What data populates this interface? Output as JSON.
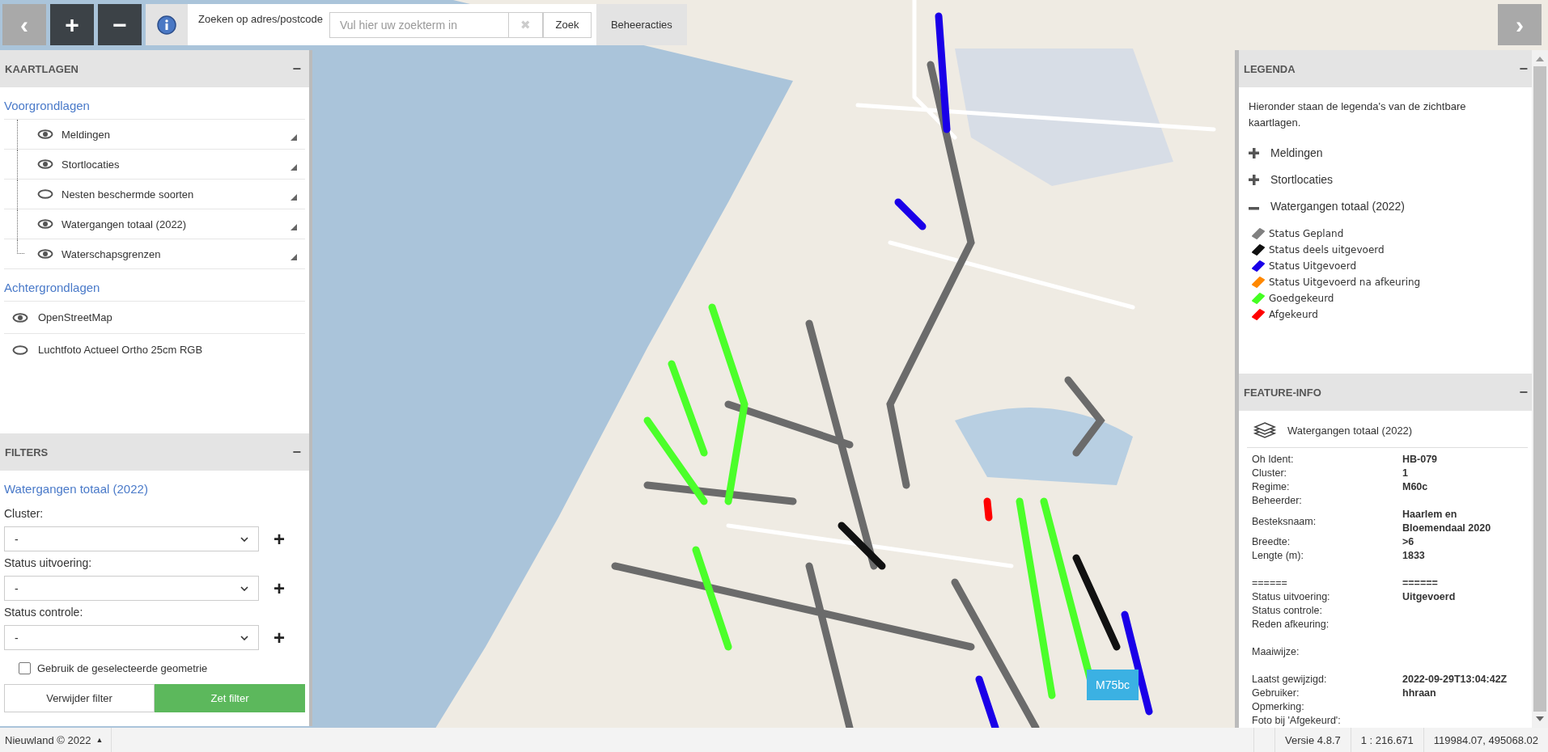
{
  "toolbar": {
    "back_button": "‹",
    "zoom_in": "+",
    "zoom_out": "−",
    "search_label": "Zoeken op adres/postcode",
    "search": {
      "placeholder": "Vul hier uw zoekterm in"
    },
    "clear_button": "✖",
    "search_button": "Zoek",
    "manage_button": "Beheeracties",
    "forward_button": "›"
  },
  "layers_panel": {
    "title": "KAARTLAGEN",
    "collapse": "−",
    "foreground": {
      "heading": "Voorgrondlagen",
      "items": [
        {
          "label": "Meldingen",
          "visible": true
        },
        {
          "label": "Stortlocaties",
          "visible": true
        },
        {
          "label": "Nesten beschermde soorten",
          "visible": false
        },
        {
          "label": "Watergangen totaal (2022)",
          "visible": true
        },
        {
          "label": "Waterschapsgrenzen",
          "visible": true
        }
      ]
    },
    "background": {
      "heading": "Achtergrondlagen",
      "items": [
        {
          "label": "OpenStreetMap",
          "visible": true
        },
        {
          "label": "Luchtfoto Actueel Ortho 25cm RGB",
          "visible": false
        }
      ]
    }
  },
  "filters_panel": {
    "title": "FILTERS",
    "collapse": "−",
    "layer": "Watergangen totaal (2022)",
    "fields": [
      {
        "label": "Cluster:",
        "value": "-"
      },
      {
        "label": "Status uitvoering:",
        "value": "-"
      },
      {
        "label": "Status controle:",
        "value": "-"
      }
    ],
    "add_button": "+",
    "checkbox": {
      "label": "Gebruik de geselecteerde geometrie",
      "checked": false
    },
    "buttons": [
      "Verwijder filter",
      "Zet filter"
    ]
  },
  "legend_panel": {
    "title": "LEGENDA",
    "collapse": "−",
    "intro": "Hieronder staan de legenda's van de zichtbare kaartlagen.",
    "groups": [
      {
        "label": "Meldingen",
        "expanded": false
      },
      {
        "label": "Stortlocaties",
        "expanded": false
      },
      {
        "label": "Watergangen totaal (2022)",
        "expanded": true,
        "items": [
          {
            "label": "Status Gepland",
            "color": "#808080"
          },
          {
            "label": "Status deels uitgevoerd",
            "color": "#111111"
          },
          {
            "label": "Status Uitgevoerd",
            "color": "#1a00e8"
          },
          {
            "label": "Status Uitgevoerd na afkeuring",
            "color": "#ff8800"
          },
          {
            "label": "Goedgekeurd",
            "color": "#44ff22"
          },
          {
            "label": "Afgekeurd",
            "color": "#ff0000"
          }
        ]
      }
    ]
  },
  "feature_panel": {
    "title": "FEATURE-INFO",
    "collapse": "−",
    "layer": "Watergangen totaal (2022)",
    "row_groups": [
      [
        {
          "label": "Oh Ident:",
          "value": "HB-079"
        },
        {
          "label": "Cluster:",
          "value": "1"
        },
        {
          "label": "Regime:",
          "value": "M60c"
        },
        {
          "label": "Beheerder:"
        },
        {
          "label": "Besteksnaam:",
          "value": "Haarlem en Bloemendaal 2020"
        },
        {
          "label": "Breedte:",
          "value": ">6"
        },
        {
          "label": "Lengte (m):",
          "value": "1833"
        }
      ],
      [
        {
          "label": "======",
          "value": "======"
        },
        {
          "label": "Status uitvoering:",
          "value": "Uitgevoerd"
        },
        {
          "label": "Status controle:"
        },
        {
          "label": "Reden afkeuring:"
        }
      ],
      [
        {
          "label": "Maaiwijze:"
        }
      ],
      [
        {
          "label": "Laatst gewijzigd:",
          "value": "2022-09-29T13:04:42Z"
        },
        {
          "label": "Gebruiker:",
          "value": "hhraan"
        },
        {
          "label": "Opmerking:"
        },
        {
          "label": "Foto bij 'Afgekeurd':"
        }
      ]
    ]
  },
  "map_label": "M75bc",
  "status_bar": {
    "copyright": "Nieuwland © 2022",
    "caret": "▲",
    "version": "Versie 4.8.7",
    "scale": "1 : 216.671",
    "coordinates": "119984.07, 495068.02"
  }
}
